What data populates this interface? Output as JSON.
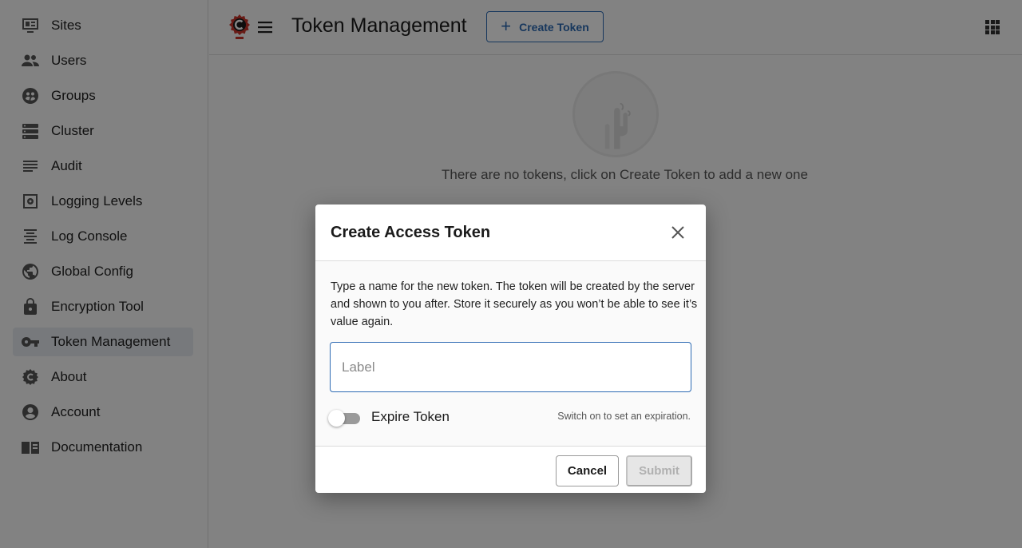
{
  "sidebar": {
    "items": [
      {
        "label": "Sites",
        "icon": "sites-icon"
      },
      {
        "label": "Users",
        "icon": "users-icon"
      },
      {
        "label": "Groups",
        "icon": "groups-icon"
      },
      {
        "label": "Cluster",
        "icon": "cluster-icon"
      },
      {
        "label": "Audit",
        "icon": "audit-icon"
      },
      {
        "label": "Logging Levels",
        "icon": "logging-levels-icon"
      },
      {
        "label": "Log Console",
        "icon": "log-console-icon"
      },
      {
        "label": "Global Config",
        "icon": "globe-icon"
      },
      {
        "label": "Encryption Tool",
        "icon": "lock-icon"
      },
      {
        "label": "Token Management",
        "icon": "key-icon",
        "active": true
      },
      {
        "label": "About",
        "icon": "crafter-icon"
      },
      {
        "label": "Account",
        "icon": "account-icon"
      },
      {
        "label": "Documentation",
        "icon": "book-icon"
      }
    ]
  },
  "header": {
    "title": "Token Management",
    "create_button": "Create Token"
  },
  "main": {
    "empty_message": "There are no tokens, click on Create Token to add a new one"
  },
  "dialog": {
    "title": "Create Access Token",
    "description": "Type a name for the new token. The token will be created by the server and shown to you after. Store it securely as you won’t be able to see it’s value again.",
    "label_input": {
      "value": "",
      "placeholder": "Label"
    },
    "expire_toggle": {
      "label": "Expire Token",
      "on": false
    },
    "hint": "Switch on to set an expiration.",
    "cancel_label": "Cancel",
    "submit_label": "Submit"
  },
  "colors": {
    "accent": "#2d6ab3",
    "brand_red": "#c8352b",
    "active_nav_bg": "#e4e8ee"
  }
}
